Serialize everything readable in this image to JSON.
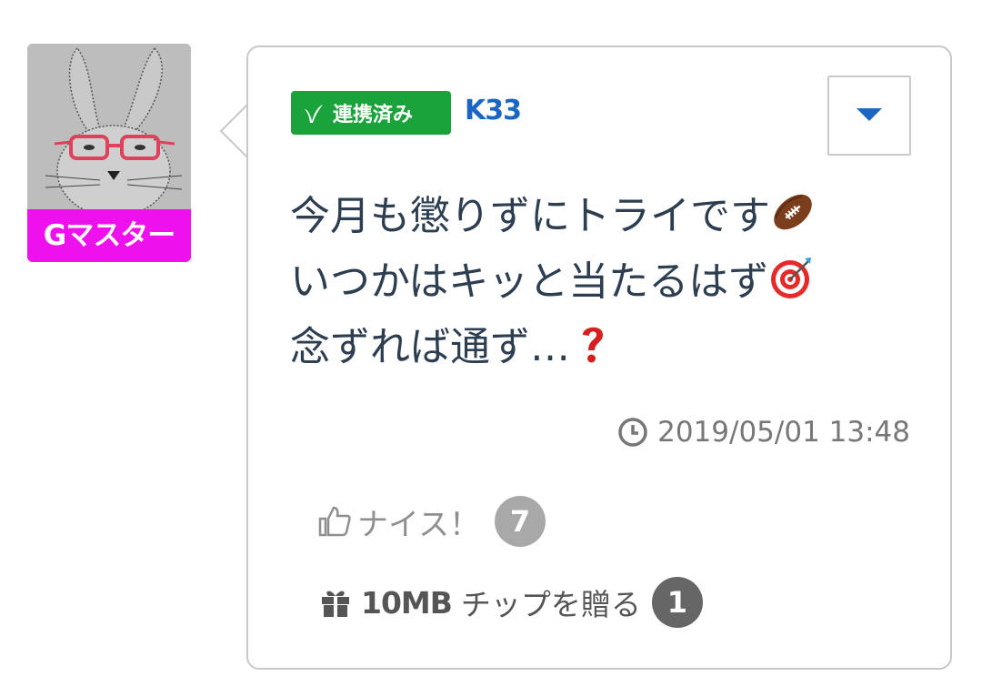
{
  "user": {
    "avatar_name": "Gマスター",
    "username": "K33"
  },
  "badge": {
    "label": "連携済み",
    "icon": "v-check-icon",
    "color": "#1aa33a"
  },
  "post": {
    "lines": [
      "今月も懲りずにトライです",
      "いつかはキッと当たるはず",
      "念ずれば通ず…"
    ],
    "emojis": [
      "football-emoji",
      "bullseye-emoji",
      "red-question-mark-emoji"
    ]
  },
  "timestamp": "2019/05/01 13:48",
  "nice": {
    "label": "ナイス！",
    "count": "7"
  },
  "tip": {
    "amount": "10MB",
    "label": "チップを贈る",
    "count": "1"
  },
  "menu": {
    "icon": "caret-down-icon"
  },
  "colors": {
    "accent": "#1a66c2",
    "avatar_label_bg": "#ee11ee",
    "text": "#2d3e50"
  }
}
